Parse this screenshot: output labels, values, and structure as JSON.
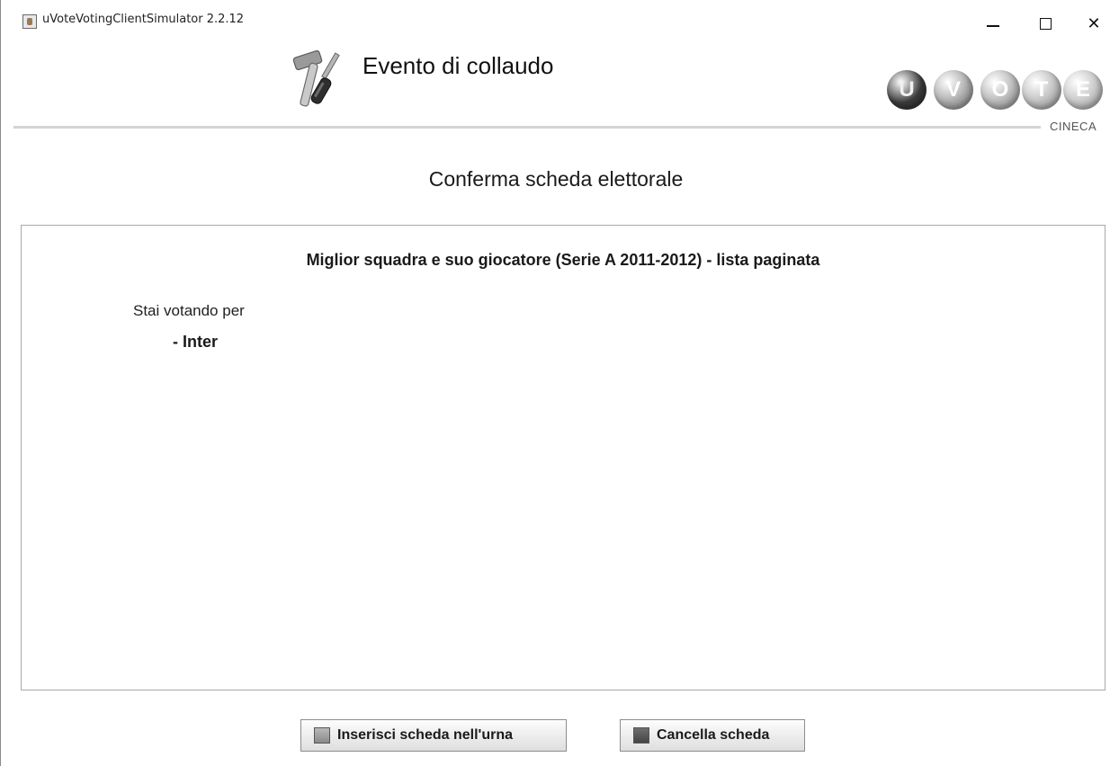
{
  "window": {
    "title": "uVoteVotingClientSimulator 2.2.12",
    "minimize_icon": "minimize-icon",
    "maximize_icon": "maximize-icon",
    "close_icon": "close-icon",
    "close_glyph": "✕"
  },
  "header": {
    "event_title": "Evento di collaudo",
    "tools_icon": "hammer-screwdriver-icon",
    "logo_letters": [
      "U",
      "V",
      "O",
      "T",
      "E"
    ],
    "logo_colors": [
      "#3a3a3a",
      "#a8a8a8",
      "#b4b4b4",
      "#bcbcbc",
      "#c4c4c4"
    ],
    "brand": "CINECA"
  },
  "page": {
    "title": "Conferma scheda elettorale"
  },
  "ballot": {
    "title": "Miglior squadra e suo giocatore (Serie A 2011-2012) - lista paginata",
    "voting_for_label": "Stai votando per",
    "choice": "- Inter"
  },
  "actions": {
    "insert_label": "Inserisci scheda nell'urna",
    "cancel_label": "Cancella scheda"
  }
}
